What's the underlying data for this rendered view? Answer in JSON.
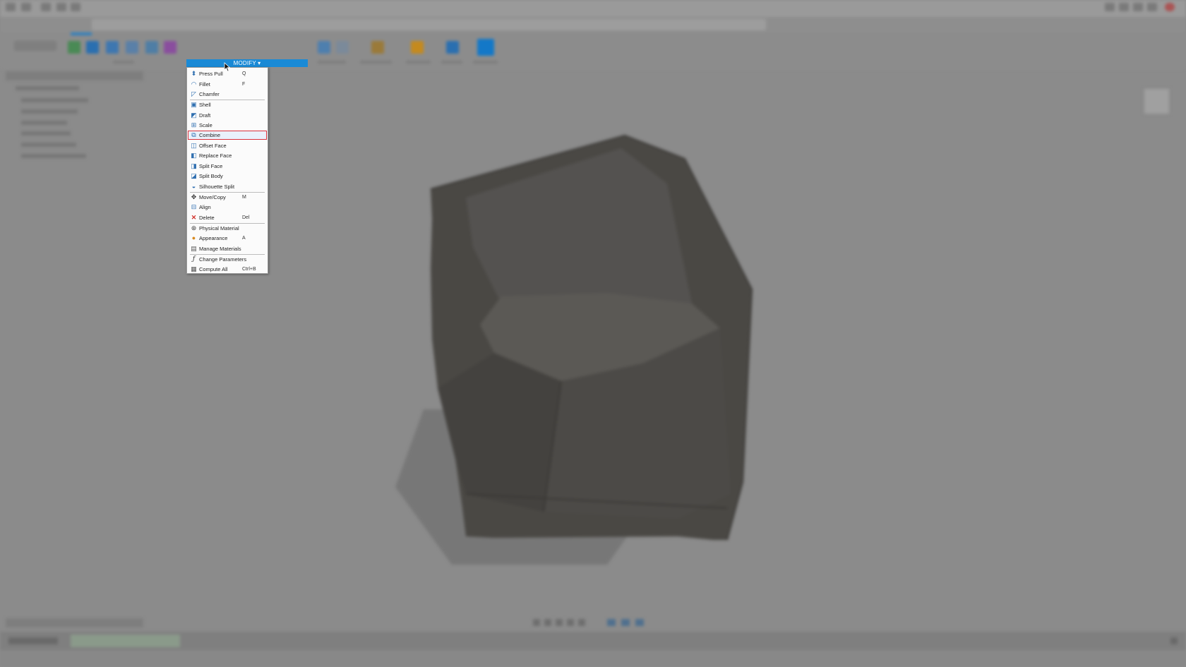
{
  "modify_menu": {
    "button_label": "MODIFY ▾",
    "accent_color": "#1a8ad6",
    "highlight_color": "#d9303a",
    "items": [
      {
        "label": "Press Pull",
        "shortcut": "Q",
        "icon": "press-pull-icon"
      },
      {
        "label": "Fillet",
        "shortcut": "F",
        "icon": "fillet-icon"
      },
      {
        "label": "Chamfer",
        "shortcut": "",
        "icon": "chamfer-icon"
      },
      {
        "label": "Shell",
        "shortcut": "",
        "icon": "shell-icon"
      },
      {
        "label": "Draft",
        "shortcut": "",
        "icon": "draft-icon"
      },
      {
        "label": "Scale",
        "shortcut": "",
        "icon": "scale-icon"
      },
      {
        "label": "Combine",
        "shortcut": "",
        "icon": "combine-icon",
        "highlighted": true
      },
      {
        "label": "Offset Face",
        "shortcut": "",
        "icon": "offset-face-icon"
      },
      {
        "label": "Replace Face",
        "shortcut": "",
        "icon": "replace-face-icon"
      },
      {
        "label": "Split Face",
        "shortcut": "",
        "icon": "split-face-icon"
      },
      {
        "label": "Split Body",
        "shortcut": "",
        "icon": "split-body-icon"
      },
      {
        "label": "Silhouette Split",
        "shortcut": "",
        "icon": "silhouette-split-icon"
      },
      {
        "label": "Move/Copy",
        "shortcut": "M",
        "icon": "move-copy-icon"
      },
      {
        "label": "Align",
        "shortcut": "",
        "icon": "align-icon"
      },
      {
        "label": "Delete",
        "shortcut": "Del",
        "icon": "delete-icon"
      },
      {
        "label": "Physical Material",
        "shortcut": "",
        "icon": "physical-material-icon"
      },
      {
        "label": "Appearance",
        "shortcut": "A",
        "icon": "appearance-icon"
      },
      {
        "label": "Manage Materials",
        "shortcut": "",
        "icon": "manage-materials-icon"
      },
      {
        "label": "Change Parameters",
        "shortcut": "",
        "icon": "change-parameters-icon"
      },
      {
        "label": "Compute All",
        "shortcut": "Ctrl+B",
        "icon": "compute-all-icon"
      }
    ]
  }
}
